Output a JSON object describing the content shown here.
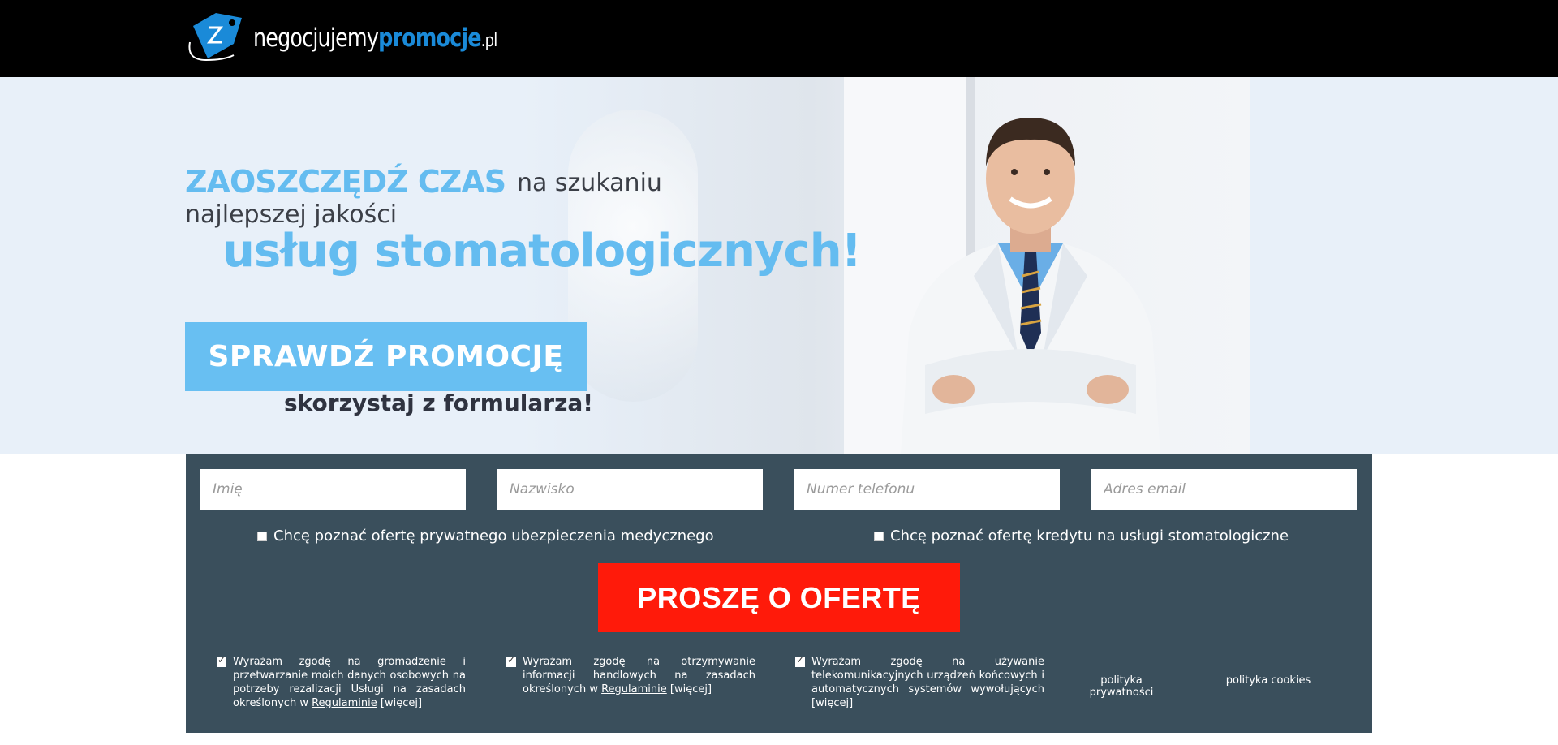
{
  "header": {
    "logo_main": "negocjujemy",
    "logo_brand": "promocje",
    "logo_tld": ".pl",
    "logo_icon": "price-tag-icon"
  },
  "hero": {
    "headline_highlight": "ZAOSZCZĘDŹ CZAS",
    "headline_rest": "na szukaniu",
    "headline_line2": "najlepszej jakości",
    "headline_big": "usług stomatologicznych!",
    "cta_label": "SPRAWDŹ PROMOCJĘ",
    "cta_sub": "skorzystaj z formularza!"
  },
  "form": {
    "first_name_placeholder": "Imię",
    "last_name_placeholder": "Nazwisko",
    "phone_placeholder": "Numer telefonu",
    "email_placeholder": "Adres email",
    "option_insurance": "Chcę poznać ofertę prywatnego ubezpieczenia medycznego",
    "option_credit": "Chcę poznać ofertę kredytu na usługi stomatologiczne",
    "submit_label": "PROSZĘ O OFERTĘ",
    "consent1_text": "Wyrażam zgodę na gromadzenie i przetwarzanie moich danych osobowych na potrzeby rezalizacji Usługi na zasadach określonych w",
    "consent2_text": "Wyrażam zgodę na otrzymywanie informacji handlowych na zasadach określonych w",
    "consent3_text": "Wyrażam zgodę na używanie telekomunikacyjnych urządzeń końcowych i automatycznych systemów wywołujących",
    "regulamin_link": "Regulaminie",
    "more_link": "[więcej]",
    "privacy_link": "polityka prywatności",
    "cookies_link": "polityka cookies"
  },
  "colors": {
    "accent_blue": "#64bcf0",
    "submit_red": "#ff1a0a",
    "form_bg": "#3a4f5c"
  }
}
